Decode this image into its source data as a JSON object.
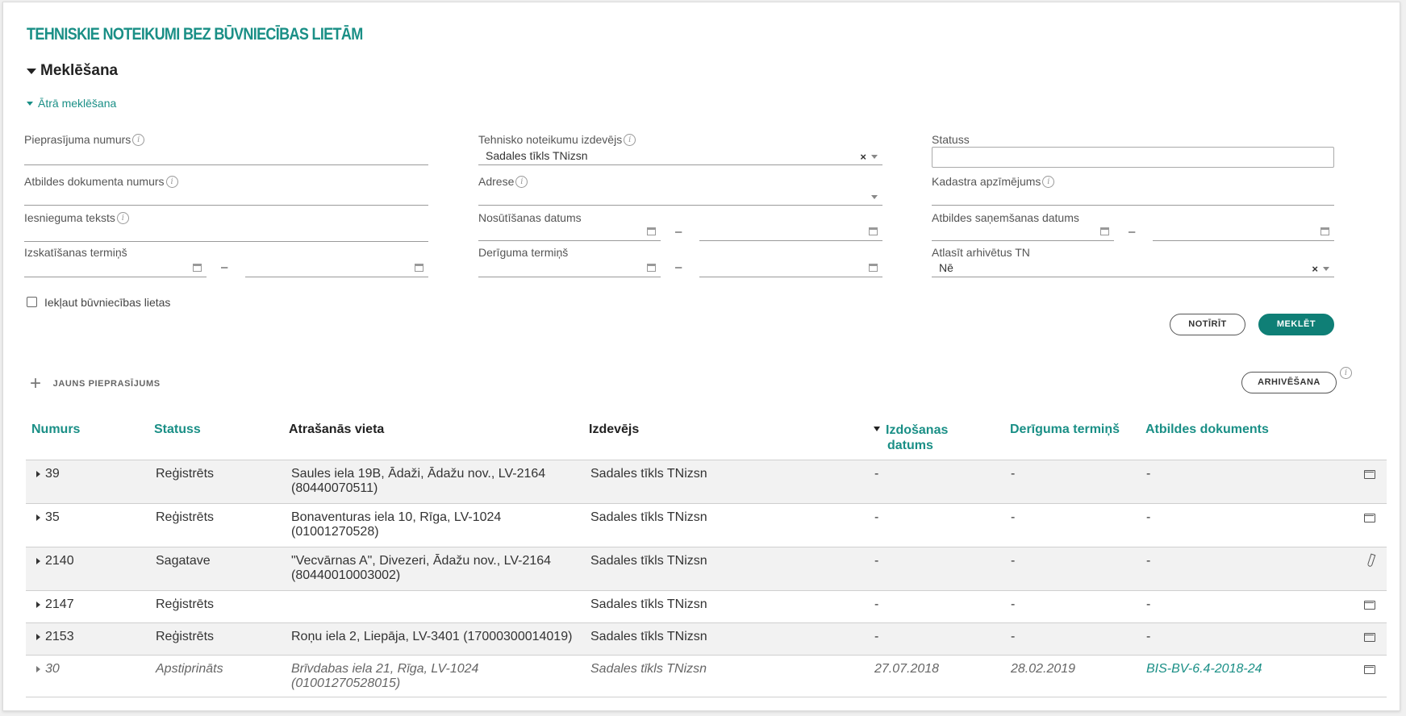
{
  "page_title": "TEHNISKIE NOTEIKUMI BEZ BŪVNIECĪBAS LIETĀM",
  "search": {
    "title": "Meklēšana",
    "quick_search": "Ātrā meklēšana",
    "fields": {
      "request_number": "Pieprasījuma numurs",
      "issuer": "Tehnisko noteikumu izdevējs",
      "issuer_value": "Sadales tīkls TNizsn",
      "status": "Statuss",
      "response_doc_number": "Atbildes dokumenta numurs",
      "address": "Adrese",
      "cadastre": "Kadastra apzīmējums",
      "application_text": "Iesnieguma teksts",
      "sent_date": "Nosūtīšanas datums",
      "response_received_date": "Atbildes saņemšanas datums",
      "review_deadline": "Izskatīšanas termiņš",
      "validity_period": "Derīguma termiņš",
      "select_archived": "Atlasīt arhivētus TN",
      "select_archived_value": "Nē"
    },
    "range_dash": "–",
    "clear_x": "×",
    "include_cases_label": "Iekļaut būvniecības lietas",
    "clear_button": "NOTĪRĪT",
    "search_button": "MEKLĒT"
  },
  "actions": {
    "new_request": "JAUNS PIEPRASĪJUMS",
    "archiving": "ARHIVĒŠANA"
  },
  "table": {
    "headers": {
      "number": "Numurs",
      "status": "Statuss",
      "location": "Atrašanās vieta",
      "issuer": "Izdevējs",
      "issue_date_line1": "Izdošanas",
      "issue_date_line2": "datums",
      "validity": "Derīguma termiņš",
      "response_doc": "Atbildes dokuments"
    },
    "rows": [
      {
        "number": "39",
        "status": "Reģistrēts",
        "loc1": "Saules iela 19B, Ādaži, Ādažu nov., LV-2164",
        "loc2": "(80440070511)",
        "issuer": "Sadales tīkls TNizsn",
        "issue_date": "-",
        "validity": "-",
        "doc": "-",
        "icon": "folder-icon"
      },
      {
        "number": "35",
        "status": "Reģistrēts",
        "loc1": "Bonaventuras iela 10, Rīga, LV-1024",
        "loc2": "(01001270528)",
        "issuer": "Sadales tīkls TNizsn",
        "issue_date": "-",
        "validity": "-",
        "doc": "-",
        "icon": "folder-icon"
      },
      {
        "number": "2140",
        "status": "Sagatave",
        "loc1": "\"Vecvārnas A\", Divezeri, Ādažu nov., LV-2164",
        "loc2": "(80440010003002)",
        "issuer": "Sadales tīkls TNizsn",
        "issue_date": "-",
        "validity": "-",
        "doc": "-",
        "icon": "pencil-icon"
      },
      {
        "number": "2147",
        "status": "Reģistrēts",
        "loc1": "",
        "loc2": "",
        "issuer": "Sadales tīkls TNizsn",
        "issue_date": "-",
        "validity": "-",
        "doc": "-",
        "icon": "folder-icon"
      },
      {
        "number": "2153",
        "status": "Reģistrēts",
        "loc1": "Roņu iela 2, Liepāja, LV-3401 (17000300014019)",
        "loc2": "",
        "issuer": "Sadales tīkls TNizsn",
        "issue_date": "-",
        "validity": "-",
        "doc": "-",
        "icon": "folder-icon"
      },
      {
        "number": "30",
        "status": "Apstiprināts",
        "loc1": "Brīvdabas iela 21, Rīga, LV-1024",
        "loc2": "(01001270528015)",
        "issuer": "Sadales tīkls TNizsn",
        "issue_date": "27.07.2018",
        "validity": "28.02.2019",
        "doc": "BIS-BV-6.4-2018-24",
        "icon": "folder-icon"
      }
    ]
  },
  "colors": {
    "accent": "#1a8f86",
    "button_fill": "#0f7f76"
  }
}
